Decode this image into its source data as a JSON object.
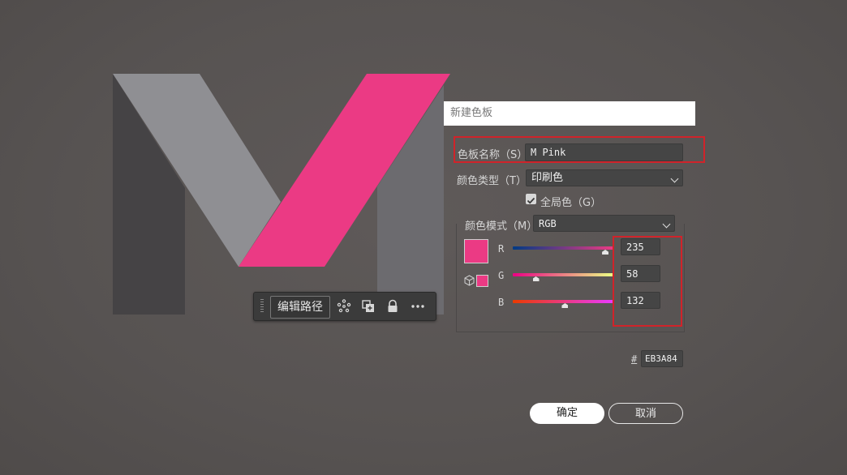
{
  "colors": {
    "swatch": "#EB3A84",
    "m_pink": "#EB3A84",
    "m_light": "#8f8f93",
    "m_dark": "#454345",
    "m_mid": "#6c6b6f",
    "highlight": "#d0232a"
  },
  "context_toolbar": {
    "edit_path_label": "编辑路径",
    "icons": [
      "transform-points-icon",
      "duplicate-icon",
      "lock-icon",
      "more-icon"
    ]
  },
  "dialog": {
    "title": "新建色板",
    "swatch_name": {
      "label": "色板名称（S）:",
      "value": "M Pink"
    },
    "swatch_type": {
      "label": "颜色类型（T）:",
      "value": "印刷色"
    },
    "global": {
      "label": "全局色（G）",
      "checked": true
    },
    "color_mode": {
      "label": "颜色模式（M）:",
      "value": "RGB"
    },
    "channels": [
      {
        "name": "R",
        "value": "235",
        "fraction": 0.92
      },
      {
        "name": "G",
        "value": "58",
        "fraction": 0.23
      },
      {
        "name": "B",
        "value": "132",
        "fraction": 0.52
      }
    ],
    "hex": {
      "prefix": "#",
      "value": "EB3A84"
    },
    "ok_label": "确定",
    "cancel_label": "取消"
  }
}
